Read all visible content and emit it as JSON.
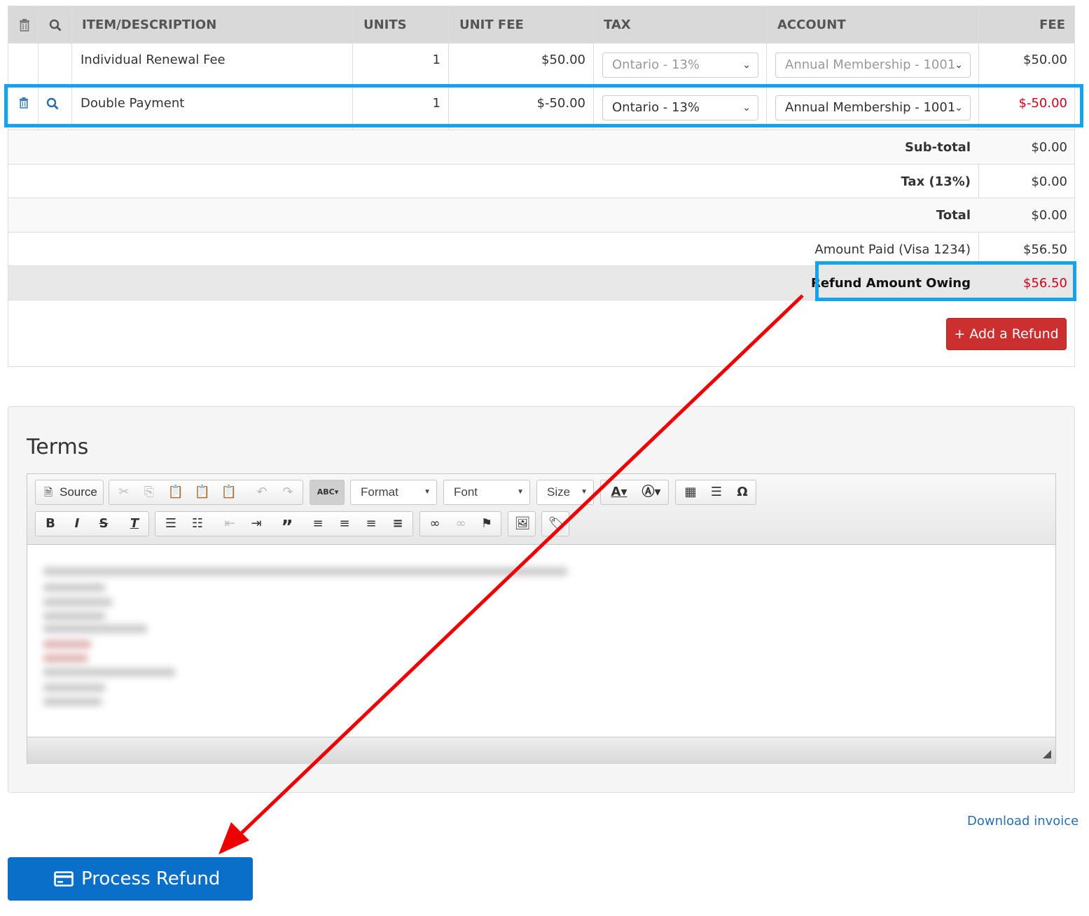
{
  "table": {
    "headers": {
      "item": "ITEM/DESCRIPTION",
      "units": "UNITS",
      "unit_fee": "UNIT FEE",
      "tax": "TAX",
      "account": "ACCOUNT",
      "fee": "FEE"
    },
    "rows": [
      {
        "description": "Individual Renewal Fee",
        "units": "1",
        "unit_fee": "$50.00",
        "tax": "Ontario - 13%",
        "account": "Annual Membership - 1001",
        "fee": "$50.00"
      },
      {
        "description": "Double Payment",
        "units": "1",
        "unit_fee": "$-50.00",
        "tax": "Ontario - 13%",
        "account": "Annual Membership - 1001",
        "fee": "$-50.00"
      }
    ],
    "totals": {
      "subtotal_label": "Sub-total",
      "subtotal": "$0.00",
      "tax_label": "Tax (13%)",
      "tax": "$0.00",
      "total_label": "Total",
      "total": "$0.00",
      "paid_label": "Amount Paid (Visa 1234)",
      "paid": "$56.50",
      "refund_label": "Refund Amount Owing",
      "refund": "$56.50"
    },
    "add_refund_label": "+ Add a Refund"
  },
  "terms": {
    "title": "Terms",
    "toolbar": {
      "source": "Source",
      "format": "Format",
      "font": "Font",
      "size": "Size"
    }
  },
  "download_label": "Download invoice",
  "process_label": "Process Refund",
  "colors": {
    "highlight": "#16a3ee",
    "arrow": "#ee0000",
    "primary": "#0a6fc9",
    "danger": "#cc2f2f",
    "negative": "#d0021b"
  }
}
